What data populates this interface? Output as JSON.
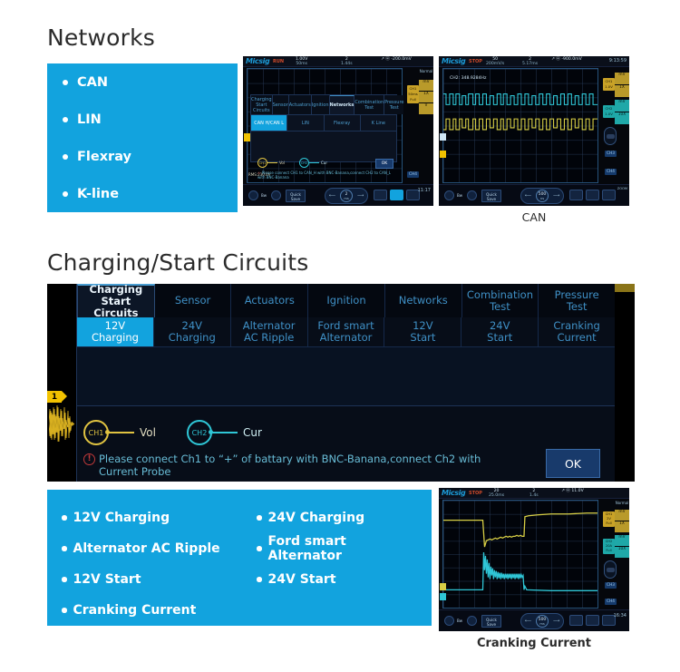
{
  "sections": {
    "networks": {
      "title": "Networks",
      "items": [
        "CAN",
        "LIN",
        "Flexray",
        "K-line"
      ]
    },
    "charging": {
      "title": "Charging/Start Circuits",
      "items": [
        "12V Charging",
        "24V Charging",
        "Alternator AC Ripple",
        "Ford smart Alternator",
        "12V Start",
        "24V Start",
        "Cranking Current"
      ]
    }
  },
  "menu": {
    "tabs": [
      "Charging\nStart Circuits",
      "Sensor",
      "Actuators",
      "Ignition",
      "Networks",
      "Combination\nTest",
      "Pressure\nTest"
    ],
    "tab_lines": [
      [
        "Charging",
        "Start Circuits"
      ],
      [
        "Sensor",
        ""
      ],
      [
        "Actuators",
        ""
      ],
      [
        "Ignition",
        ""
      ],
      [
        "Networks",
        ""
      ],
      [
        "Combination",
        "Test"
      ],
      [
        "Pressure",
        "Test"
      ]
    ],
    "charging_subtabs": [
      [
        "12V",
        "Charging"
      ],
      [
        "24V",
        "Charging"
      ],
      [
        "Alternator",
        "AC Ripple"
      ],
      [
        "Ford smart",
        "Alternator"
      ],
      [
        "12V",
        "Start"
      ],
      [
        "24V",
        "Start"
      ],
      [
        "Cranking",
        "Current"
      ]
    ],
    "networks_subtabs": [
      "CAN H/CAN L",
      "LIN",
      "Flexray",
      "K Line"
    ],
    "active_tab_index": 0,
    "active_sub_index": 0,
    "networks_active_tab_index": 4,
    "networks_active_sub_index": 0
  },
  "charging_panel": {
    "probe_ch1": "CH1",
    "probe_ch1_label": "Vol",
    "probe_ch2": "CH2",
    "probe_ch2_label": "Cur",
    "warn_icon": "!",
    "warn_text": "Please connect Ch1 to  “+”  of battary with BNC-Banana,connect Ch2 with Current Probe",
    "ok_label": "OK",
    "channel_marker": "1"
  },
  "scopes": {
    "networks_menu": {
      "brand": "Micsig",
      "run_state": "RUN",
      "top_fields": [
        {
          "top": "1.00V",
          "bot": "50ms"
        },
        {
          "top": "2",
          "bot": "1.44s"
        },
        {
          "top": "↗ ⓦ -200.0mV",
          "bot": ""
        }
      ],
      "trigger_mode": "Normal",
      "rail_ch1": "CH1\n50ms\nFull",
      "rail_units": [
        "mV",
        "1X",
        "V"
      ],
      "clock": "11:17",
      "bottom": {
        "bw_label": "Bw",
        "quick_save": "Quick\nSave",
        "timebase_value": "2",
        "timebase_unit": "ms"
      },
      "rms_label": "RMS:230.0V"
    },
    "can": {
      "brand": "Micsig",
      "run_state": "STOP",
      "caption": "CAN",
      "freq_label": "CH2: 348.9284Hz",
      "top_fields": [
        {
          "top": "50",
          "bot": "200mV/s"
        },
        {
          "top": "2",
          "bot": "5.17ms"
        },
        {
          "top": "↗ ⓦ -900.0mV",
          "bot": ""
        }
      ],
      "top_extra": [
        "-900.0mV",
        "-900.0mV",
        "-900.0mV"
      ],
      "clock": "9:13:59",
      "rail_ch1": "CH1\n1.0V",
      "rail_ch2": "CH2\n1.0V",
      "rail_btn3": "CH3",
      "rail_btn4": "CH4",
      "rail_units_ch1": [
        "mV",
        "1X",
        "V"
      ],
      "rail_units_ch2": [
        "mV",
        "10X",
        "V"
      ],
      "zoom_label": "ZOOM",
      "bottom": {
        "bw_label": "Bw",
        "quick_save": "Quick\nSave",
        "timebase_value": "500",
        "timebase_unit": "ns"
      }
    },
    "cranking": {
      "brand": "Micsig",
      "run_state": "STOP",
      "caption": "Cranking Current",
      "top_fields": [
        {
          "top": "20",
          "bot": "25.0ms"
        },
        {
          "top": "2",
          "bot": "1.4s"
        },
        {
          "top": "↗ ⓦ 11.0V",
          "bot": ""
        }
      ],
      "trigger_mode": "Normal",
      "rail_ch1": "CH1\n2V\nFull",
      "rail_ch2": "CH2\n20A\nFull",
      "rail_btn3": "CH3",
      "rail_btn4": "CH4",
      "rail_units_ch1": [
        "mV",
        "1X",
        "V"
      ],
      "rail_units_ch2": [
        "mV",
        "10X",
        "V"
      ],
      "clock": "16:34",
      "bottom": {
        "bw_label": "Bw",
        "quick_save": "Quick\nSave",
        "timebase_value": "500",
        "timebase_unit": "ms"
      }
    }
  },
  "colors": {
    "brand_blue": "#12A3DE",
    "panel_dark": "#070d18",
    "ch1_yellow": "#e0c341",
    "ch2_cyan": "#2fc6d6",
    "warn_red": "#c33a3a",
    "ok_blue": "#183a6b"
  }
}
